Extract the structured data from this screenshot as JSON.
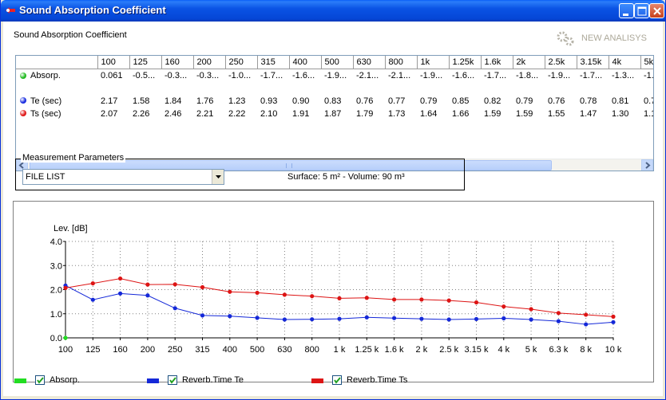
{
  "window": {
    "title": "Sound Absorption Coefficient"
  },
  "header": {
    "label": "Sound Absorption Coefficient",
    "new_analysis": "NEW ANALISYS"
  },
  "table": {
    "columns": [
      "100",
      "125",
      "160",
      "200",
      "250",
      "315",
      "400",
      "500",
      "630",
      "800",
      "1k",
      "1.25k",
      "1.6k",
      "2k",
      "2.5k",
      "3.15k",
      "4k",
      "5k"
    ],
    "rows": [
      {
        "label": "Absorp.",
        "color": "#22bb22",
        "values": [
          "0.061",
          "-0.5...",
          "-0.3...",
          "-0.3...",
          "-1.0...",
          "-1.7...",
          "-1.6...",
          "-1.9...",
          "-2.1...",
          "-2.1...",
          "-1.9...",
          "-1.6...",
          "-1.7...",
          "-1.8...",
          "-1.9...",
          "-1.7...",
          "-1.3...",
          "-1."
        ]
      },
      {
        "label": "",
        "color": "",
        "values": [
          "",
          "",
          "",
          "",
          "",
          "",
          "",
          "",
          "",
          "",
          "",
          "",
          "",
          "",
          "",
          "",
          "",
          ""
        ]
      },
      {
        "label": "Te (sec)",
        "color": "#1a2ee0",
        "values": [
          "2.17",
          "1.58",
          "1.84",
          "1.76",
          "1.23",
          "0.93",
          "0.90",
          "0.83",
          "0.76",
          "0.77",
          "0.79",
          "0.85",
          "0.82",
          "0.79",
          "0.76",
          "0.78",
          "0.81",
          "0.7"
        ]
      },
      {
        "label": "Ts (sec)",
        "color": "#e01a1a",
        "values": [
          "2.07",
          "2.26",
          "2.46",
          "2.21",
          "2.22",
          "2.10",
          "1.91",
          "1.87",
          "1.79",
          "1.73",
          "1.64",
          "1.66",
          "1.59",
          "1.59",
          "1.55",
          "1.47",
          "1.30",
          "1.1"
        ]
      }
    ]
  },
  "measurement": {
    "legend": "Measurement Parameters",
    "selected": "FILE LIST",
    "surface_volume": "Surface: 5 m² - Volume: 90 m³"
  },
  "chart_data": {
    "type": "line",
    "ylabel": "Lev. [dB]",
    "ylim": [
      0,
      4
    ],
    "yticks": [
      "0.0",
      "1.0",
      "2.0",
      "3.0",
      "4.0"
    ],
    "categories": [
      "100",
      "125",
      "160",
      "200",
      "250",
      "315",
      "400",
      "500",
      "630",
      "800",
      "1 k",
      "1.25 k",
      "1.6 k",
      "2 k",
      "2.5 k",
      "3.15 k",
      "4 k",
      "5 k",
      "6.3 k",
      "8 k",
      "10 k"
    ],
    "grid": true,
    "series": [
      {
        "name": "Absorp.",
        "color": "#22dd22",
        "values": [
          0.0,
          null,
          null,
          null,
          null,
          null,
          null,
          null,
          null,
          null,
          null,
          null,
          null,
          null,
          null,
          null,
          null,
          null,
          null,
          null,
          null
        ]
      },
      {
        "name": "Reverb.Time Te",
        "color": "#1428d8",
        "values": [
          2.17,
          1.58,
          1.84,
          1.76,
          1.23,
          0.93,
          0.9,
          0.83,
          0.76,
          0.77,
          0.79,
          0.85,
          0.82,
          0.79,
          0.76,
          0.78,
          0.81,
          0.76,
          0.69,
          0.56,
          0.65
        ]
      },
      {
        "name": "Reverb.Time Ts",
        "color": "#dd1414",
        "values": [
          2.07,
          2.26,
          2.46,
          2.21,
          2.22,
          2.1,
          1.91,
          1.87,
          1.79,
          1.73,
          1.64,
          1.66,
          1.59,
          1.59,
          1.55,
          1.47,
          1.3,
          1.19,
          1.03,
          0.96,
          0.88
        ]
      }
    ]
  },
  "legend": [
    {
      "label": "Absorp.",
      "color": "#22dd22",
      "checked": true
    },
    {
      "label": "Reverb.Time Te",
      "color": "#1428d8",
      "checked": true
    },
    {
      "label": "Reverb.Time Ts",
      "color": "#dd1414",
      "checked": true
    }
  ]
}
